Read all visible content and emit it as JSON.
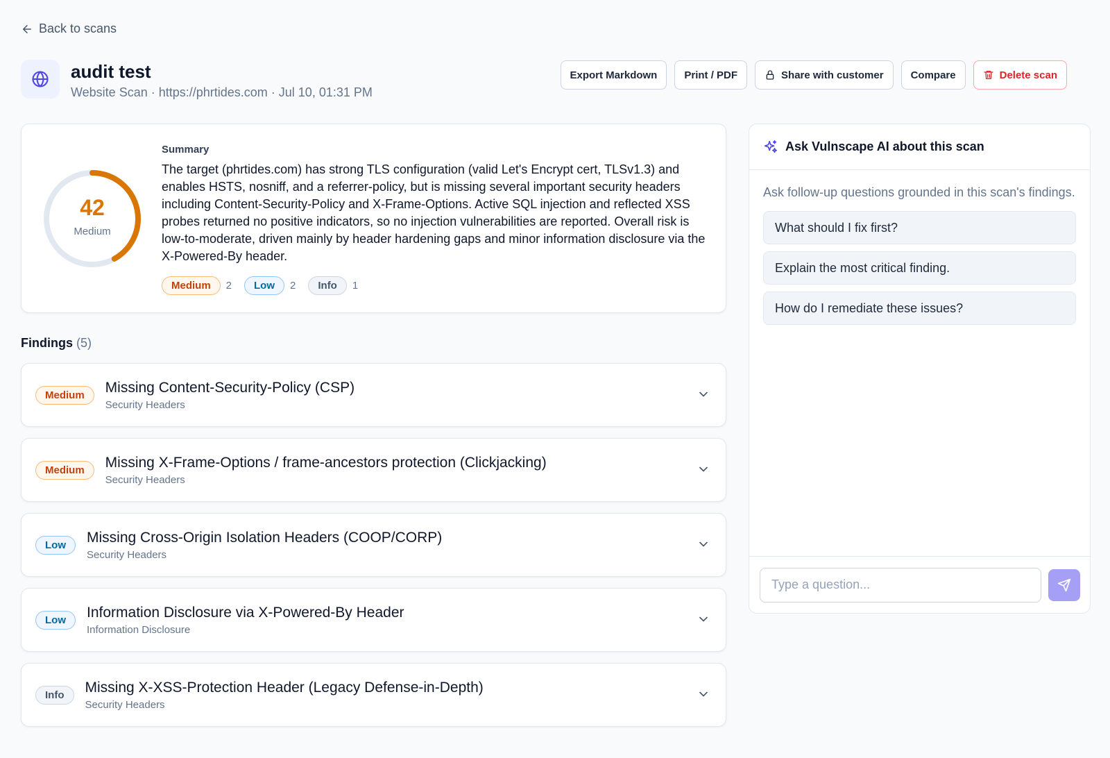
{
  "nav": {
    "back_label": "Back to scans"
  },
  "scan": {
    "title": "audit test",
    "subtitle": "Website Scan · https://phrtides.com · Jul 10, 01:31 PM"
  },
  "actions": {
    "export": "Export Markdown",
    "print": "Print / PDF",
    "share": "Share with customer",
    "compare": "Compare",
    "delete": "Delete scan"
  },
  "summary": {
    "score": "42",
    "score_label": "Medium",
    "score_fraction": 0.42,
    "label": "Summary",
    "text": "The target (phrtides.com) has strong TLS configuration (valid Let's Encrypt cert, TLSv1.3) and enables HSTS, nosniff, and a referrer-policy, but is missing several important security headers including Content-Security-Policy and X-Frame-Options. Active SQL injection and reflected XSS probes returned no positive indicators, so no injection vulnerabilities are reported. Overall risk is low-to-moderate, driven mainly by header hardening gaps and minor information disclosure via the X-Powered-By header.",
    "counts": [
      {
        "label": "Medium",
        "count": "2"
      },
      {
        "label": "Low",
        "count": "2"
      },
      {
        "label": "Info",
        "count": "1"
      }
    ]
  },
  "findings": {
    "heading": "Findings",
    "count": "(5)",
    "items": [
      {
        "severity": "Medium",
        "title": "Missing Content-Security-Policy (CSP)",
        "category": "Security Headers"
      },
      {
        "severity": "Medium",
        "title": "Missing X-Frame-Options / frame-ancestors protection (Clickjacking)",
        "category": "Security Headers"
      },
      {
        "severity": "Low",
        "title": "Missing Cross-Origin Isolation Headers (COOP/CORP)",
        "category": "Security Headers"
      },
      {
        "severity": "Low",
        "title": "Information Disclosure via X-Powered-By Header",
        "category": "Information Disclosure"
      },
      {
        "severity": "Info",
        "title": "Missing X-XSS-Protection Header (Legacy Defense-in-Depth)",
        "category": "Security Headers"
      }
    ]
  },
  "ai": {
    "title": "Ask Vulnscape AI about this scan",
    "intro": "Ask follow-up questions grounded in this scan's findings.",
    "suggestions": [
      "What should I fix first?",
      "Explain the most critical finding.",
      "How do I remediate these issues?"
    ],
    "input_placeholder": "Type a question...",
    "input_value": ""
  },
  "colors": {
    "accent": "#4f46e5",
    "gauge": "#d97706",
    "gauge_track": "#e2e8f0",
    "send": "#a5a0f5"
  },
  "icons": [
    "arrow-left-icon",
    "globe-icon",
    "lock-icon",
    "trash-icon",
    "sparkles-icon",
    "chevron-down-icon",
    "send-icon"
  ]
}
